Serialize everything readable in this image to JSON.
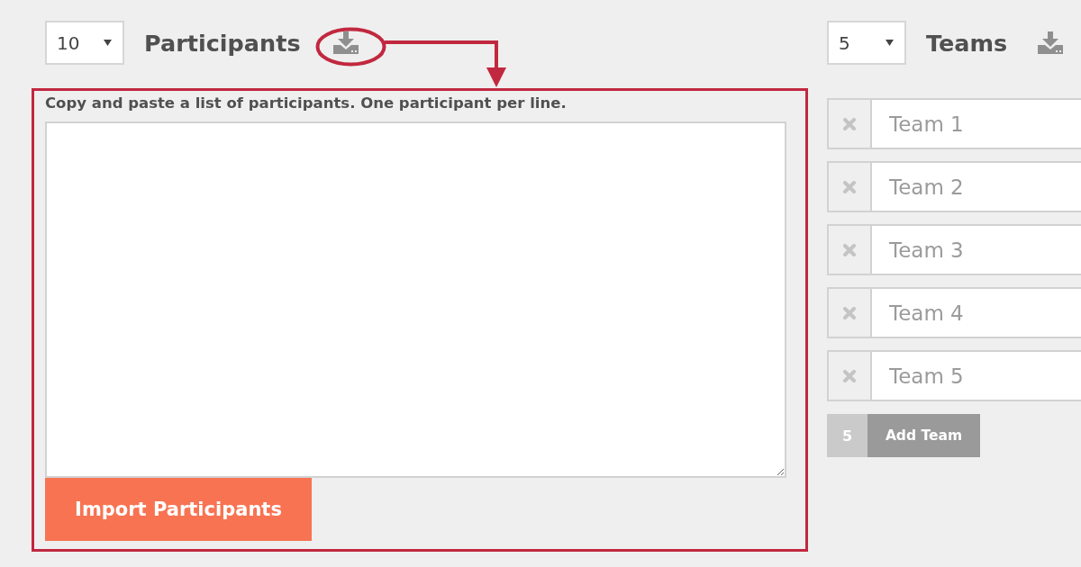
{
  "participants": {
    "count_select": {
      "value": "10"
    },
    "title": "Participants",
    "instructions": "Copy and paste a list of participants. One participant per line.",
    "import_button": "Import Participants"
  },
  "teams": {
    "count_select": {
      "value": "5"
    },
    "title": "Teams",
    "rows": [
      {
        "placeholder": "Team 1"
      },
      {
        "placeholder": "Team 2"
      },
      {
        "placeholder": "Team 3"
      },
      {
        "placeholder": "Team 4"
      },
      {
        "placeholder": "Team 5"
      }
    ],
    "add_count": "5",
    "add_button": "Add Team"
  }
}
